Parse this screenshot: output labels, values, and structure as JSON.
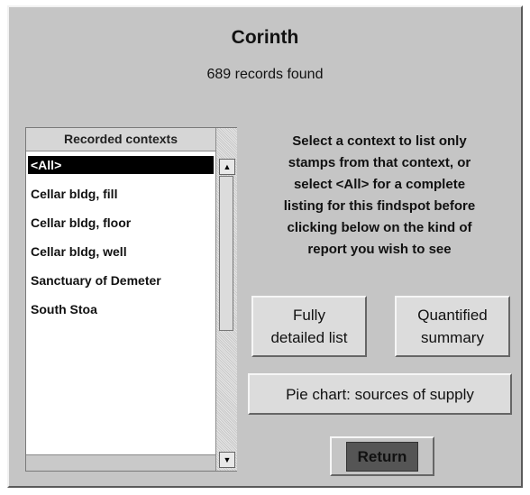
{
  "header": {
    "title": "Corinth",
    "records_found": "689 records found"
  },
  "contexts": {
    "header": "Recorded contexts",
    "items": [
      {
        "label": "<All>",
        "selected": true
      },
      {
        "label": "Cellar bldg, fill"
      },
      {
        "label": "Cellar bldg, floor"
      },
      {
        "label": "Cellar bldg, well"
      },
      {
        "label": "Sanctuary of Demeter"
      },
      {
        "label": "South Stoa"
      }
    ]
  },
  "instructions": {
    "lines": [
      "Select a context to list only",
      "stamps from that context, or",
      "select <All> for a complete",
      "listing for this findspot before",
      "clicking below on the kind of",
      "report you wish to see"
    ]
  },
  "buttons": {
    "detailed_line1": "Fully",
    "detailed_line2": "detailed list",
    "quantified_line1": "Quantified",
    "quantified_line2": "summary",
    "pie_chart": "Pie chart: sources of supply",
    "return": "Return"
  },
  "icons": {
    "scroll_up": "scroll-up-arrow-icon",
    "scroll_down": "scroll-down-arrow-icon"
  }
}
